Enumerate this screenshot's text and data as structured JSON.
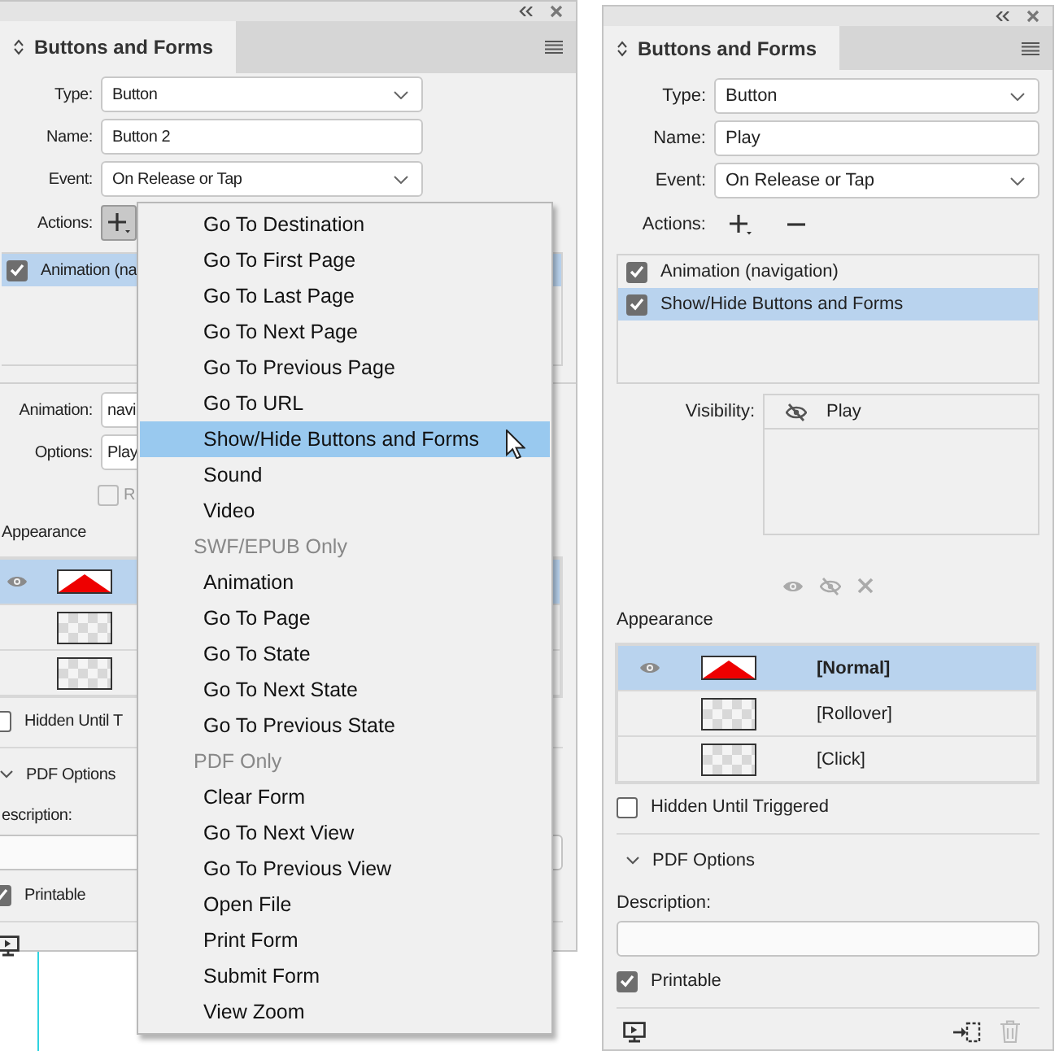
{
  "left_panel": {
    "title": "Buttons and Forms",
    "fields": [
      {
        "label": "Type:",
        "value": "Button",
        "kind": "select"
      },
      {
        "label": "Name:",
        "value": "Button 2",
        "kind": "text"
      },
      {
        "label": "Event:",
        "value": "On Release or Tap",
        "kind": "select"
      }
    ],
    "actions_label": "Actions:",
    "action_buttons": [
      {
        "kind": "add",
        "pressed": true
      }
    ],
    "actions": [
      {
        "label": "Animation (na",
        "checked": true,
        "selected": true
      }
    ],
    "action_settings": [
      {
        "label": "Animation:",
        "value": "navi"
      },
      {
        "label": "Options:",
        "value": "Play"
      }
    ],
    "option_checkbox": {
      "label": "R",
      "checked": false,
      "disabled": true
    },
    "appearance_label": "Appearance",
    "states": [
      {
        "kind": "shape",
        "visible": true,
        "selected": true
      },
      {
        "kind": "empty",
        "visible": false,
        "selected": false
      },
      {
        "kind": "empty",
        "visible": false,
        "selected": false
      }
    ],
    "hidden_until_triggered": {
      "label": "Hidden Until T",
      "checked": false
    },
    "pdf_options": {
      "label": "PDF Options",
      "expanded": true
    },
    "description_label": "escription:",
    "printable": {
      "label": "Printable",
      "checked": true
    },
    "footer": [
      {
        "kind": "preview",
        "disabled": false
      }
    ]
  },
  "menu": {
    "items": [
      {
        "kind": "item",
        "label": "Go To Destination",
        "selected": false
      },
      {
        "kind": "item",
        "label": "Go To First Page",
        "selected": false
      },
      {
        "kind": "item",
        "label": "Go To Last Page",
        "selected": false
      },
      {
        "kind": "item",
        "label": "Go To Next Page",
        "selected": false
      },
      {
        "kind": "item",
        "label": "Go To Previous Page",
        "selected": false
      },
      {
        "kind": "item",
        "label": "Go To URL",
        "selected": false
      },
      {
        "kind": "item",
        "label": "Show/Hide Buttons and Forms",
        "selected": true
      },
      {
        "kind": "item",
        "label": "Sound",
        "selected": false
      },
      {
        "kind": "item",
        "label": "Video",
        "selected": false
      },
      {
        "kind": "header",
        "label": "SWF/EPUB Only"
      },
      {
        "kind": "item",
        "label": "Animation",
        "selected": false
      },
      {
        "kind": "item",
        "label": "Go To Page",
        "selected": false
      },
      {
        "kind": "item",
        "label": "Go To State",
        "selected": false
      },
      {
        "kind": "item",
        "label": "Go To Next State",
        "selected": false
      },
      {
        "kind": "item",
        "label": "Go To Previous State",
        "selected": false
      },
      {
        "kind": "header",
        "label": "PDF Only"
      },
      {
        "kind": "item",
        "label": "Clear Form",
        "selected": false
      },
      {
        "kind": "item",
        "label": "Go To Next View",
        "selected": false
      },
      {
        "kind": "item",
        "label": "Go To Previous View",
        "selected": false
      },
      {
        "kind": "item",
        "label": "Open File",
        "selected": false
      },
      {
        "kind": "item",
        "label": "Print Form",
        "selected": false
      },
      {
        "kind": "item",
        "label": "Submit Form",
        "selected": false
      },
      {
        "kind": "item",
        "label": "View Zoom",
        "selected": false
      }
    ]
  },
  "right_panel": {
    "title": "Buttons and Forms",
    "fields": [
      {
        "label": "Type:",
        "value": "Button",
        "kind": "select"
      },
      {
        "label": "Name:",
        "value": "Play",
        "kind": "text"
      },
      {
        "label": "Event:",
        "value": "On Release or Tap",
        "kind": "select"
      }
    ],
    "actions_label": "Actions:",
    "action_buttons": [
      {
        "kind": "add",
        "pressed": false
      },
      {
        "kind": "remove",
        "pressed": false
      }
    ],
    "actions": [
      {
        "label": "Animation (navigation)",
        "checked": true,
        "selected": false
      },
      {
        "label": "Show/Hide Buttons and Forms",
        "checked": true,
        "selected": true
      }
    ],
    "visibility": {
      "label": "Visibility:",
      "items": [
        {
          "name": "Play",
          "visible": false
        }
      ]
    },
    "appearance_label": "Appearance",
    "states": [
      {
        "kind": "shape",
        "label": "[Normal]",
        "visible": true,
        "selected": true
      },
      {
        "kind": "empty",
        "label": "[Rollover]",
        "visible": false,
        "selected": false
      },
      {
        "kind": "empty",
        "label": "[Click]",
        "visible": false,
        "selected": false
      }
    ],
    "hidden_until_triggered": {
      "label": "Hidden Until Triggered",
      "checked": false
    },
    "pdf_options": {
      "label": "PDF Options",
      "expanded": true
    },
    "description_label": "Description:",
    "printable": {
      "label": "Printable",
      "checked": true
    },
    "footer": [
      {
        "kind": "preview",
        "disabled": false
      },
      {
        "kind": "convert",
        "disabled": false
      },
      {
        "kind": "delete",
        "disabled": true
      }
    ]
  }
}
